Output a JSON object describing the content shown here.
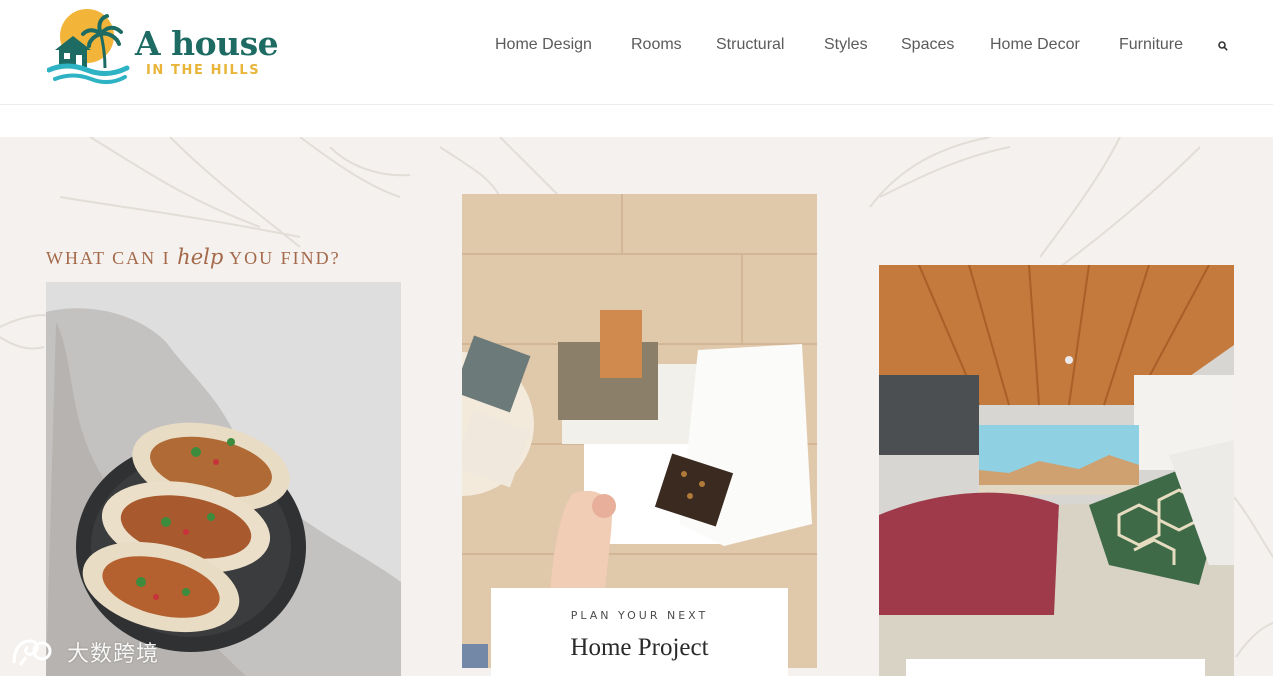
{
  "brand": {
    "title": "A house",
    "subtitle": "IN THE HILLS",
    "colors": {
      "teal": "#1d6b63",
      "gold": "#e8b53a",
      "wave": "#2eb3c4",
      "sun": "#f2b53a"
    }
  },
  "nav": {
    "items": [
      {
        "label": "Home Design"
      },
      {
        "label": "Rooms"
      },
      {
        "label": "Structural"
      },
      {
        "label": "Styles"
      },
      {
        "label": "Spaces"
      },
      {
        "label": "Home Decor"
      },
      {
        "label": "Furniture"
      }
    ],
    "search_icon": "search-icon"
  },
  "hero": {
    "heading_before": "WHAT CAN I",
    "heading_script": "help",
    "heading_after": "YOU FIND?",
    "heading_color": "#a4694a",
    "background": "#f4f1ee",
    "cards": [
      {
        "name": "tacos-photo"
      },
      {
        "name": "home-project-photo",
        "eyebrow": "PLAN YOUR NEXT",
        "title": "Home Project"
      },
      {
        "name": "van-bedroom-photo"
      }
    ]
  },
  "watermark": {
    "text": "大数跨境"
  }
}
